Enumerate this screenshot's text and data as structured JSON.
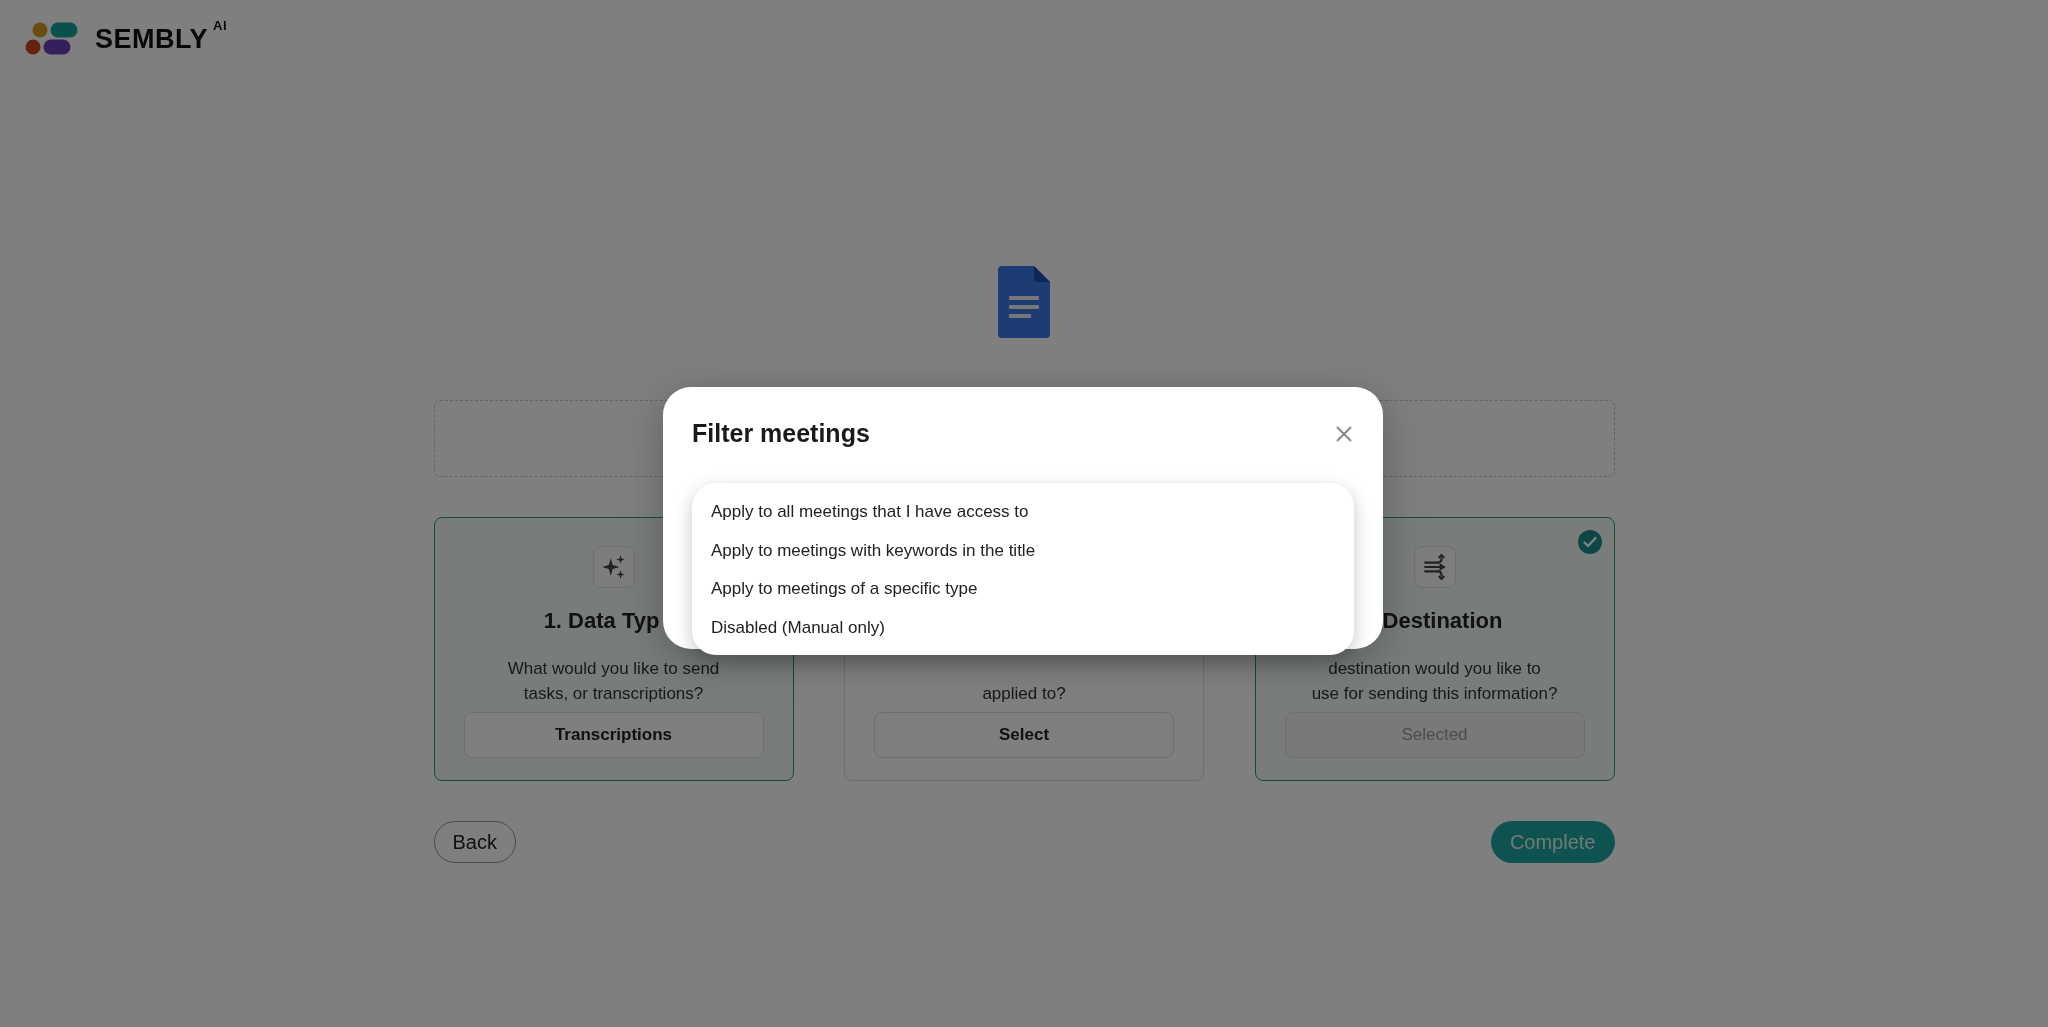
{
  "logo": {
    "name": "SEMBLY",
    "superscript": "AI"
  },
  "cards": [
    {
      "kind": "sparkles",
      "title": "1. Data Typ",
      "description": [
        "What would you like to send",
        "tasks, or transcriptions?"
      ],
      "button": {
        "label": "Transcriptions",
        "disabled": false
      },
      "selected": true
    },
    {
      "kind": "blank",
      "description": [
        "applied to?"
      ],
      "button": {
        "label": "Select",
        "disabled": false
      },
      "selected": false
    },
    {
      "kind": "arrows",
      "title": "Destination",
      "description": [
        "destination would you like to",
        "use for sending this information?"
      ],
      "button": {
        "label": "Selected",
        "disabled": true
      },
      "selected": true,
      "checked": true
    }
  ],
  "footer": {
    "back": "Back",
    "complete": "Complete"
  },
  "modal": {
    "title": "Filter meetings",
    "options": [
      {
        "label": "Apply to all meetings that I have access to"
      },
      {
        "label": "Apply to meetings with keywords in the title"
      },
      {
        "label": "Apply to meetings of a specific type"
      },
      {
        "label": "Disabled (Manual only)"
      }
    ]
  }
}
